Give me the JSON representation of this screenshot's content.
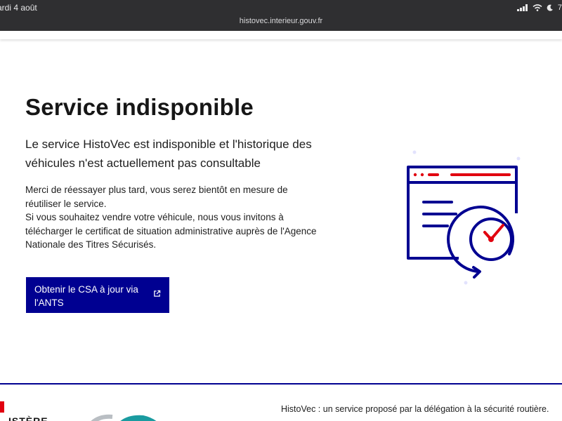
{
  "statusbar": {
    "date": "ardi 4 août",
    "url": "histovec.interieur.gouv.fr",
    "battery_text": "7"
  },
  "main": {
    "title": "Service indisponible",
    "lead": "Le service HistoVec est indisponible et l'historique des véhicules n'est actuellement pas consultable",
    "paragraph1": "Merci de réessayer plus tard, vous serez bientôt en mesure de réutiliser le service.",
    "paragraph2": "Si vous souhaitez vendre votre véhicule, nous vous invitons à télécharger le certificat de situation administrative auprès de l'Agence Nationale des Titres Sécurisés.",
    "cta_label": "Obtenir le CSA à jour via l'ANTS",
    "cta_icon": "external-link-icon"
  },
  "illustration": {
    "icon": "browser-window-clock-icon",
    "colors": {
      "blue": "#000091",
      "red": "#e1000f",
      "dots": "#e3e3fd"
    }
  },
  "footer": {
    "ministere": "ISTÈRE",
    "text": "HistoVec : un service proposé par la délégation à la sécurité routière."
  },
  "colors": {
    "primary": "#000091",
    "accent": "#e1000f",
    "topbar": "#2f2f31"
  }
}
